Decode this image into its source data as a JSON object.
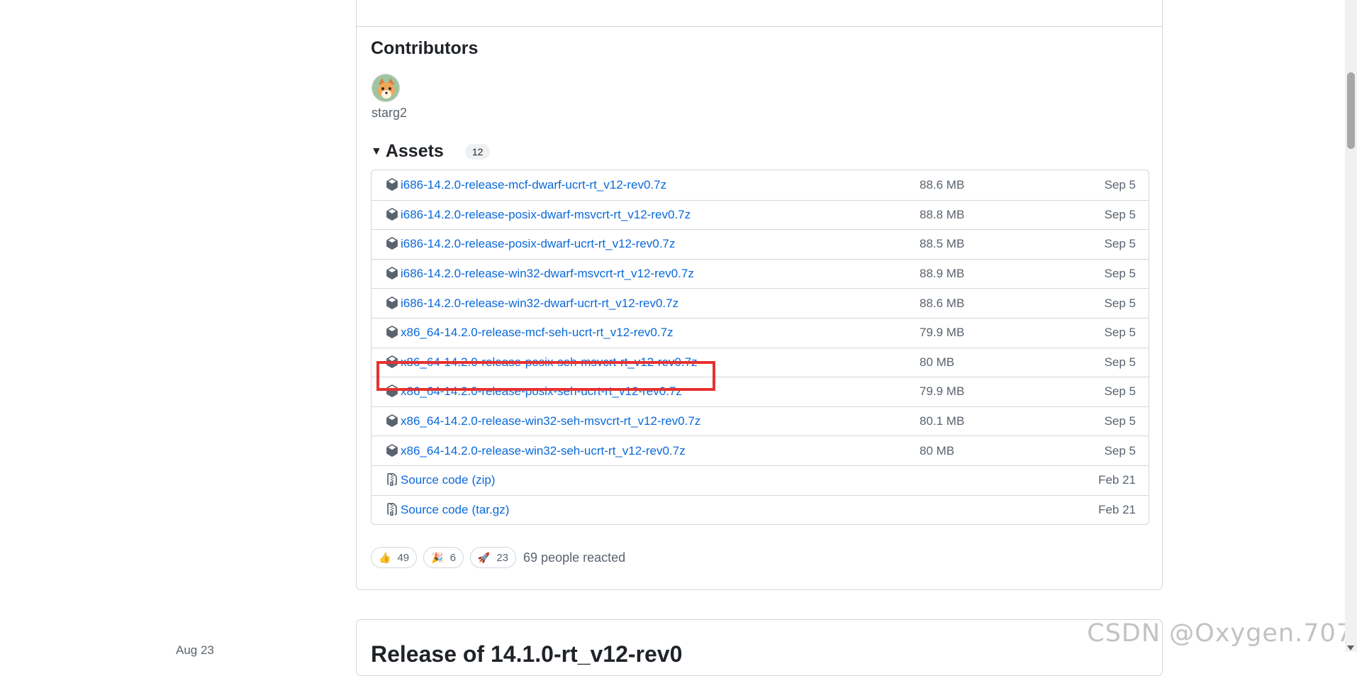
{
  "contributors": {
    "title": "Contributors",
    "names": [
      "starg2"
    ]
  },
  "assets": {
    "title": "Assets",
    "count": "12",
    "items": [
      {
        "name": "i686-14.2.0-release-mcf-dwarf-ucrt-rt_v12-rev0.7z",
        "suffix": "",
        "size": "88.6 MB",
        "date": "Sep 5",
        "icon": "package-icon"
      },
      {
        "name": "i686-14.2.0-release-posix-dwarf-msvcrt-rt_v12-rev0.7z",
        "suffix": "",
        "size": "88.8 MB",
        "date": "Sep 5",
        "icon": "package-icon"
      },
      {
        "name": "i686-14.2.0-release-posix-dwarf-ucrt-rt_v12-rev0.7z",
        "suffix": "",
        "size": "88.5 MB",
        "date": "Sep 5",
        "icon": "package-icon"
      },
      {
        "name": "i686-14.2.0-release-win32-dwarf-msvcrt-rt_v12-rev0.7z",
        "suffix": "",
        "size": "88.9 MB",
        "date": "Sep 5",
        "icon": "package-icon"
      },
      {
        "name": "i686-14.2.0-release-win32-dwarf-ucrt-rt_v12-rev0.7z",
        "suffix": "",
        "size": "88.6 MB",
        "date": "Sep 5",
        "icon": "package-icon"
      },
      {
        "name": "x86_64-14.2.0-release-mcf-seh-ucrt-rt_v12-rev0.7z",
        "suffix": "",
        "size": "79.9 MB",
        "date": "Sep 5",
        "icon": "package-icon"
      },
      {
        "name": "x86_64-14.2.0-release-posix-seh-msvcrt-rt_v12-rev0.7z",
        "suffix": "",
        "size": "80 MB",
        "date": "Sep 5",
        "icon": "package-icon"
      },
      {
        "name": "x86_64-14.2.0-release-posix-seh-ucrt-rt_v12-rev0.7z",
        "suffix": "",
        "size": "79.9 MB",
        "date": "Sep 5",
        "icon": "package-icon"
      },
      {
        "name": "x86_64-14.2.0-release-win32-seh-msvcrt-rt_v12-rev0.7z",
        "suffix": "",
        "size": "80.1 MB",
        "date": "Sep 5",
        "icon": "package-icon"
      },
      {
        "name": "x86_64-14.2.0-release-win32-seh-ucrt-rt_v12-rev0.7z",
        "suffix": "",
        "size": "80 MB",
        "date": "Sep 5",
        "icon": "package-icon"
      },
      {
        "name": "Source code",
        "suffix": "(zip)",
        "size": "",
        "date": "Feb 21",
        "icon": "file-zip-icon"
      },
      {
        "name": "Source code",
        "suffix": "(tar.gz)",
        "size": "",
        "date": "Feb 21",
        "icon": "file-zip-icon"
      }
    ]
  },
  "reactions": {
    "items": [
      {
        "emoji": "👍",
        "count": "49",
        "icon": "thumbs-up-icon"
      },
      {
        "emoji": "🎉",
        "count": "6",
        "icon": "party-popper-icon"
      },
      {
        "emoji": "🚀",
        "count": "23",
        "icon": "rocket-icon"
      }
    ],
    "summary": "69 people reacted"
  },
  "next_release": {
    "title": "Release of 14.1.0-rt_v12-rev0",
    "date": "Aug 23"
  },
  "watermark": "CSDN @Oxygen.707",
  "colors": {
    "link": "#0969da",
    "highlight": "#e63232",
    "border": "#d0d7de",
    "muted": "#59636e"
  }
}
